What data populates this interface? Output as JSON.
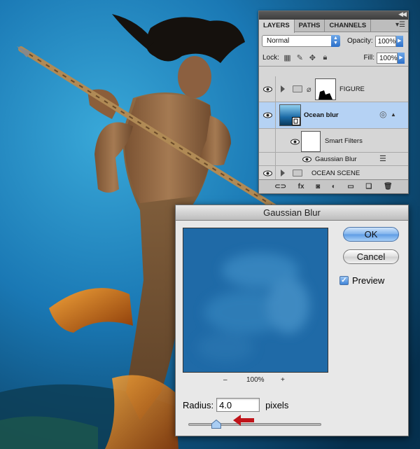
{
  "layers_panel": {
    "tabs": [
      "LAYERS",
      "PATHS",
      "CHANNELS"
    ],
    "blend_mode": "Normal",
    "opacity_label": "Opacity:",
    "opacity_value": "100%",
    "lock_label": "Lock:",
    "fill_label": "Fill:",
    "fill_value": "100%",
    "layers": [
      {
        "name": "FIGURE",
        "type": "group-with-mask"
      },
      {
        "name": "Ocean blur",
        "type": "smart-object",
        "selected": true
      },
      {
        "name": "Smart Filters",
        "type": "smart-filters"
      },
      {
        "name": "Gaussian Blur",
        "type": "filter"
      },
      {
        "name": "OCEAN SCENE",
        "type": "group"
      }
    ],
    "bottom_icons": [
      "link-icon",
      "fx-icon",
      "mask-icon",
      "adjustment-icon",
      "folder-icon",
      "new-layer-icon",
      "trash-icon"
    ],
    "fx_label": "fx"
  },
  "dialog": {
    "title": "Gaussian Blur",
    "ok_label": "OK",
    "cancel_label": "Cancel",
    "preview_label": "Preview",
    "preview_checked": true,
    "zoom_out": "–",
    "zoom_level": "100%",
    "zoom_in": "+",
    "radius_label": "Radius:",
    "radius_value": "4.0",
    "radius_unit": "pixels"
  },
  "colors": {
    "ocean": "#1b6aa6",
    "selected_layer": "#b5d2f4",
    "annotation_arrow": "#c0141a"
  }
}
